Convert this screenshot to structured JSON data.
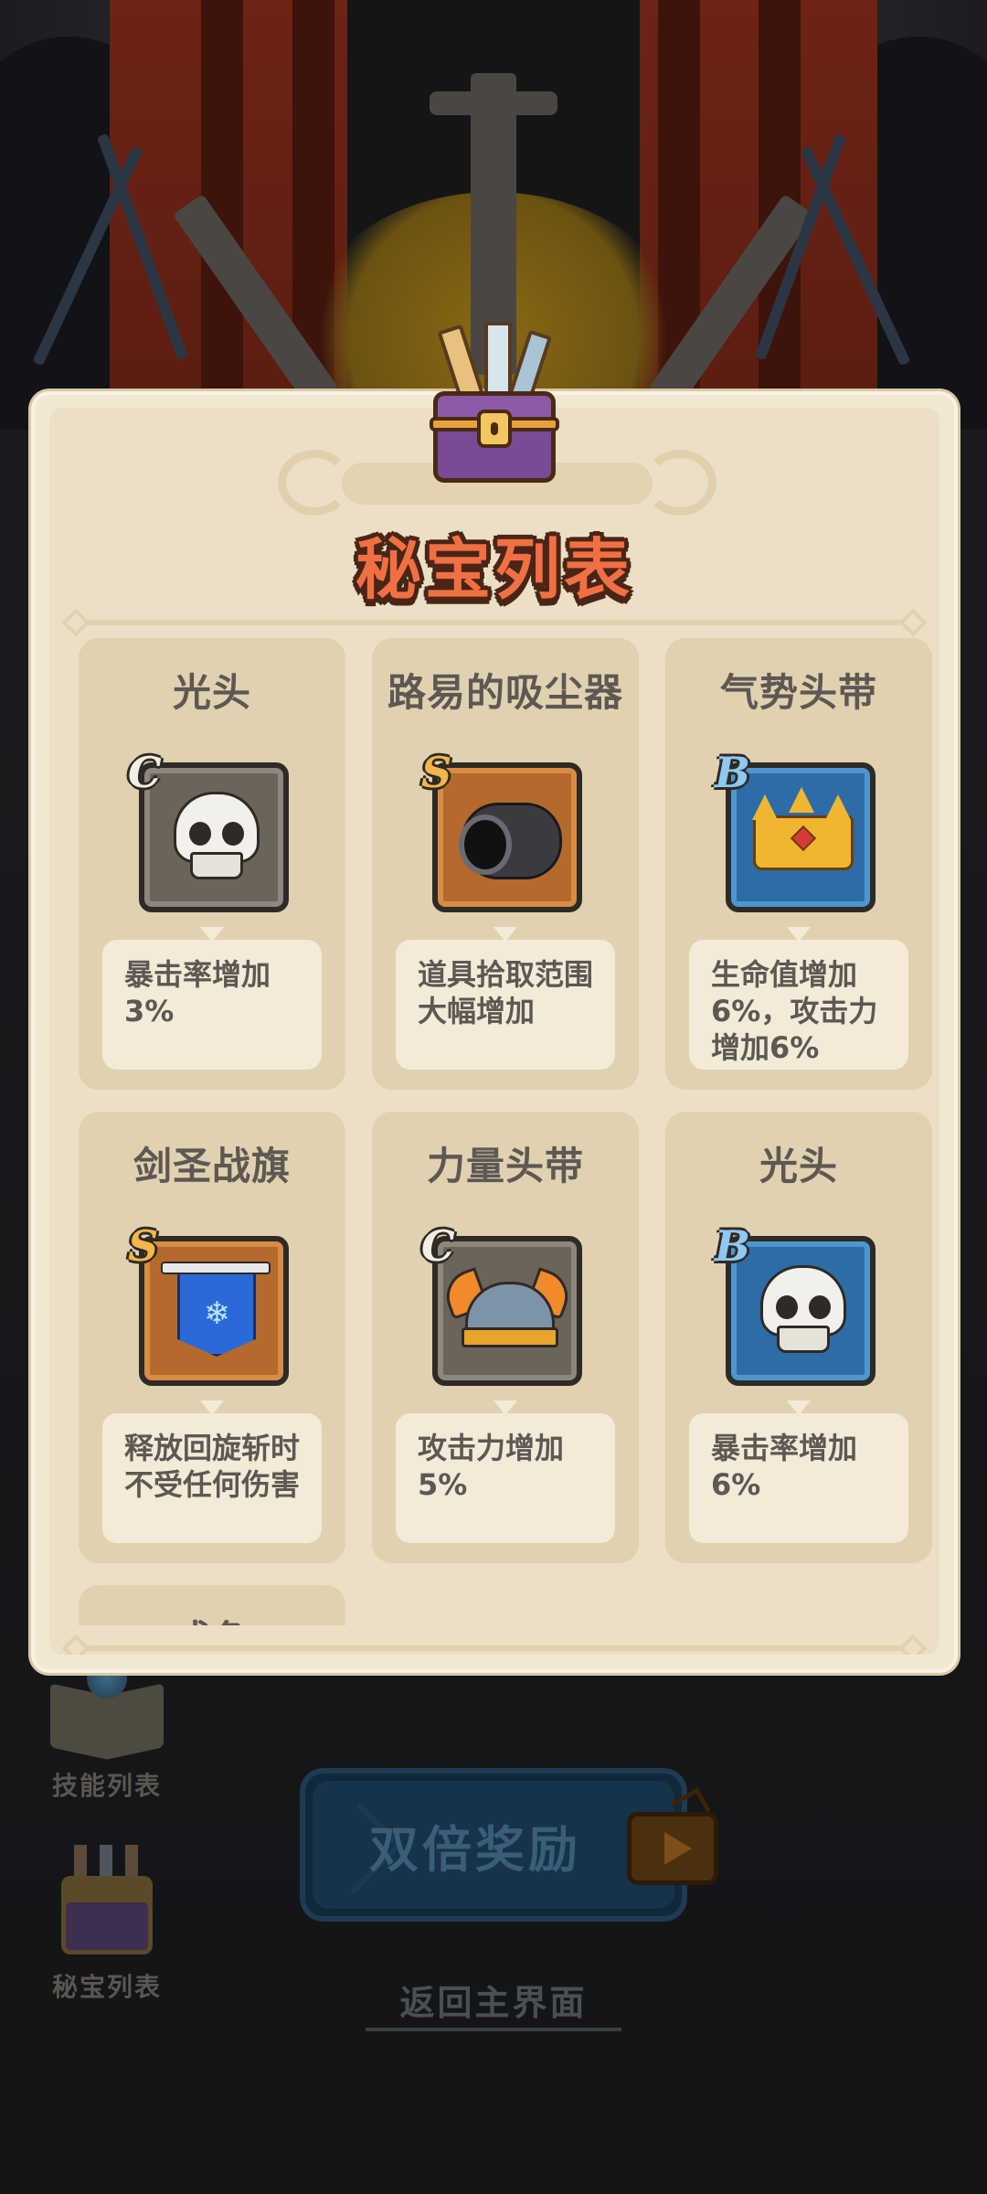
{
  "modal": {
    "title": "秘宝列表"
  },
  "items": [
    {
      "name": "光头",
      "rank": "C",
      "icon": "skull-icon",
      "desc": "暴击率增加3%"
    },
    {
      "name": "路易的吸尘器",
      "rank": "S",
      "icon": "cannon-icon",
      "desc": "道具拾取范围大幅增加"
    },
    {
      "name": "气势头带",
      "rank": "B",
      "icon": "crown-icon",
      "desc": "生命值增加6%，攻击力增加6%"
    },
    {
      "name": "剑圣战旗",
      "rank": "S",
      "icon": "banner-flag-icon",
      "desc": "释放回旋斩时不受任何伤害"
    },
    {
      "name": "力量头带",
      "rank": "C",
      "icon": "winged-helmet-icon",
      "desc": "攻击力增加5%"
    },
    {
      "name": "光头",
      "rank": "B",
      "icon": "skull-icon",
      "desc": "暴击率增加6%"
    },
    {
      "name": "成色",
      "rank": "",
      "icon": "",
      "desc": ""
    }
  ],
  "sidebar": {
    "skills_label": "技能列表",
    "treasures_label": "秘宝列表"
  },
  "reward_button": {
    "label": "双倍奖励",
    "icon": "tv-play-icon"
  },
  "home_link": "返回主界面",
  "colors": {
    "title": "#f07043",
    "rank_C": "#f4efe2",
    "rank_S": "#f3b64a",
    "rank_B": "#8fc8f0",
    "card_bg": "#e0d1b1",
    "modal_bg": "#ebe0c6"
  }
}
